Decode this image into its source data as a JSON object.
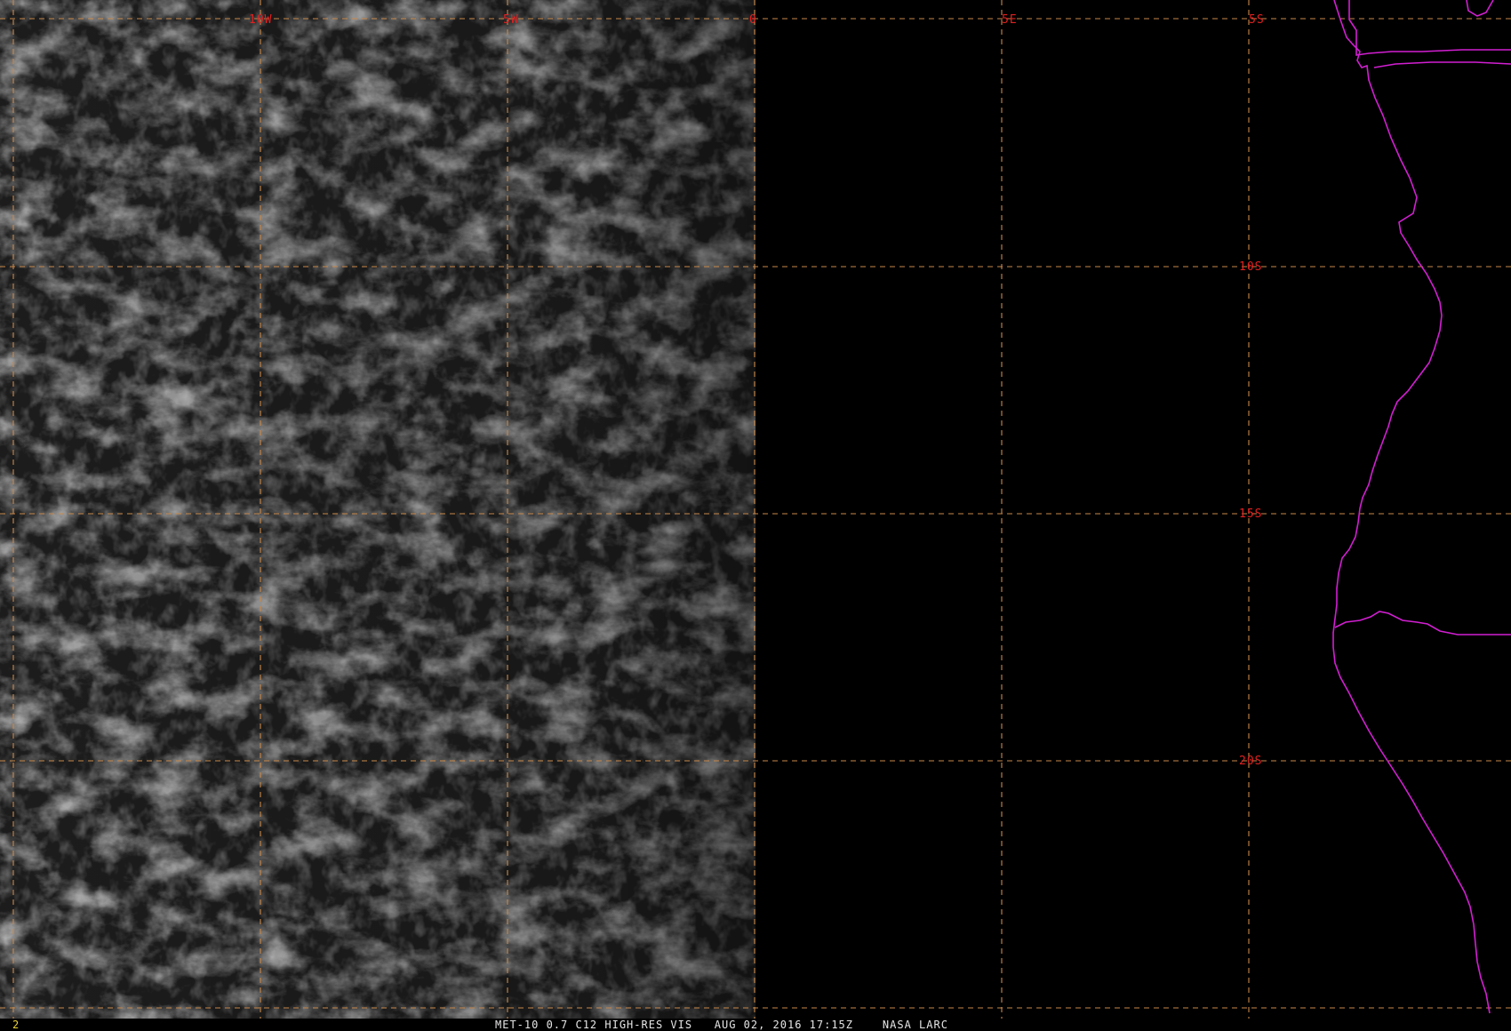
{
  "image": {
    "satellite": "MET-10",
    "channel": "0.7 C12 HIGH-RES VIS",
    "date": "AUG 02, 2016",
    "time": "17:15Z",
    "source": "NASA LARC",
    "frame": "2"
  },
  "status": {
    "text": "MET-10 0.7 C12 HIGH-RES VIS   AUG 02, 2016 17:15Z    NASA LARC",
    "frame_number": "2"
  },
  "grid": {
    "longitude_labels": [
      "10W",
      "5W",
      "0",
      "5E"
    ],
    "latitude_labels": [
      "5S",
      "10S",
      "15S",
      "20S"
    ]
  },
  "colors": {
    "grid": "#c8884a",
    "labels": "#e02020",
    "coastline": "#d21fd2",
    "background": "#000000",
    "frame_number": "#e8d33a"
  }
}
